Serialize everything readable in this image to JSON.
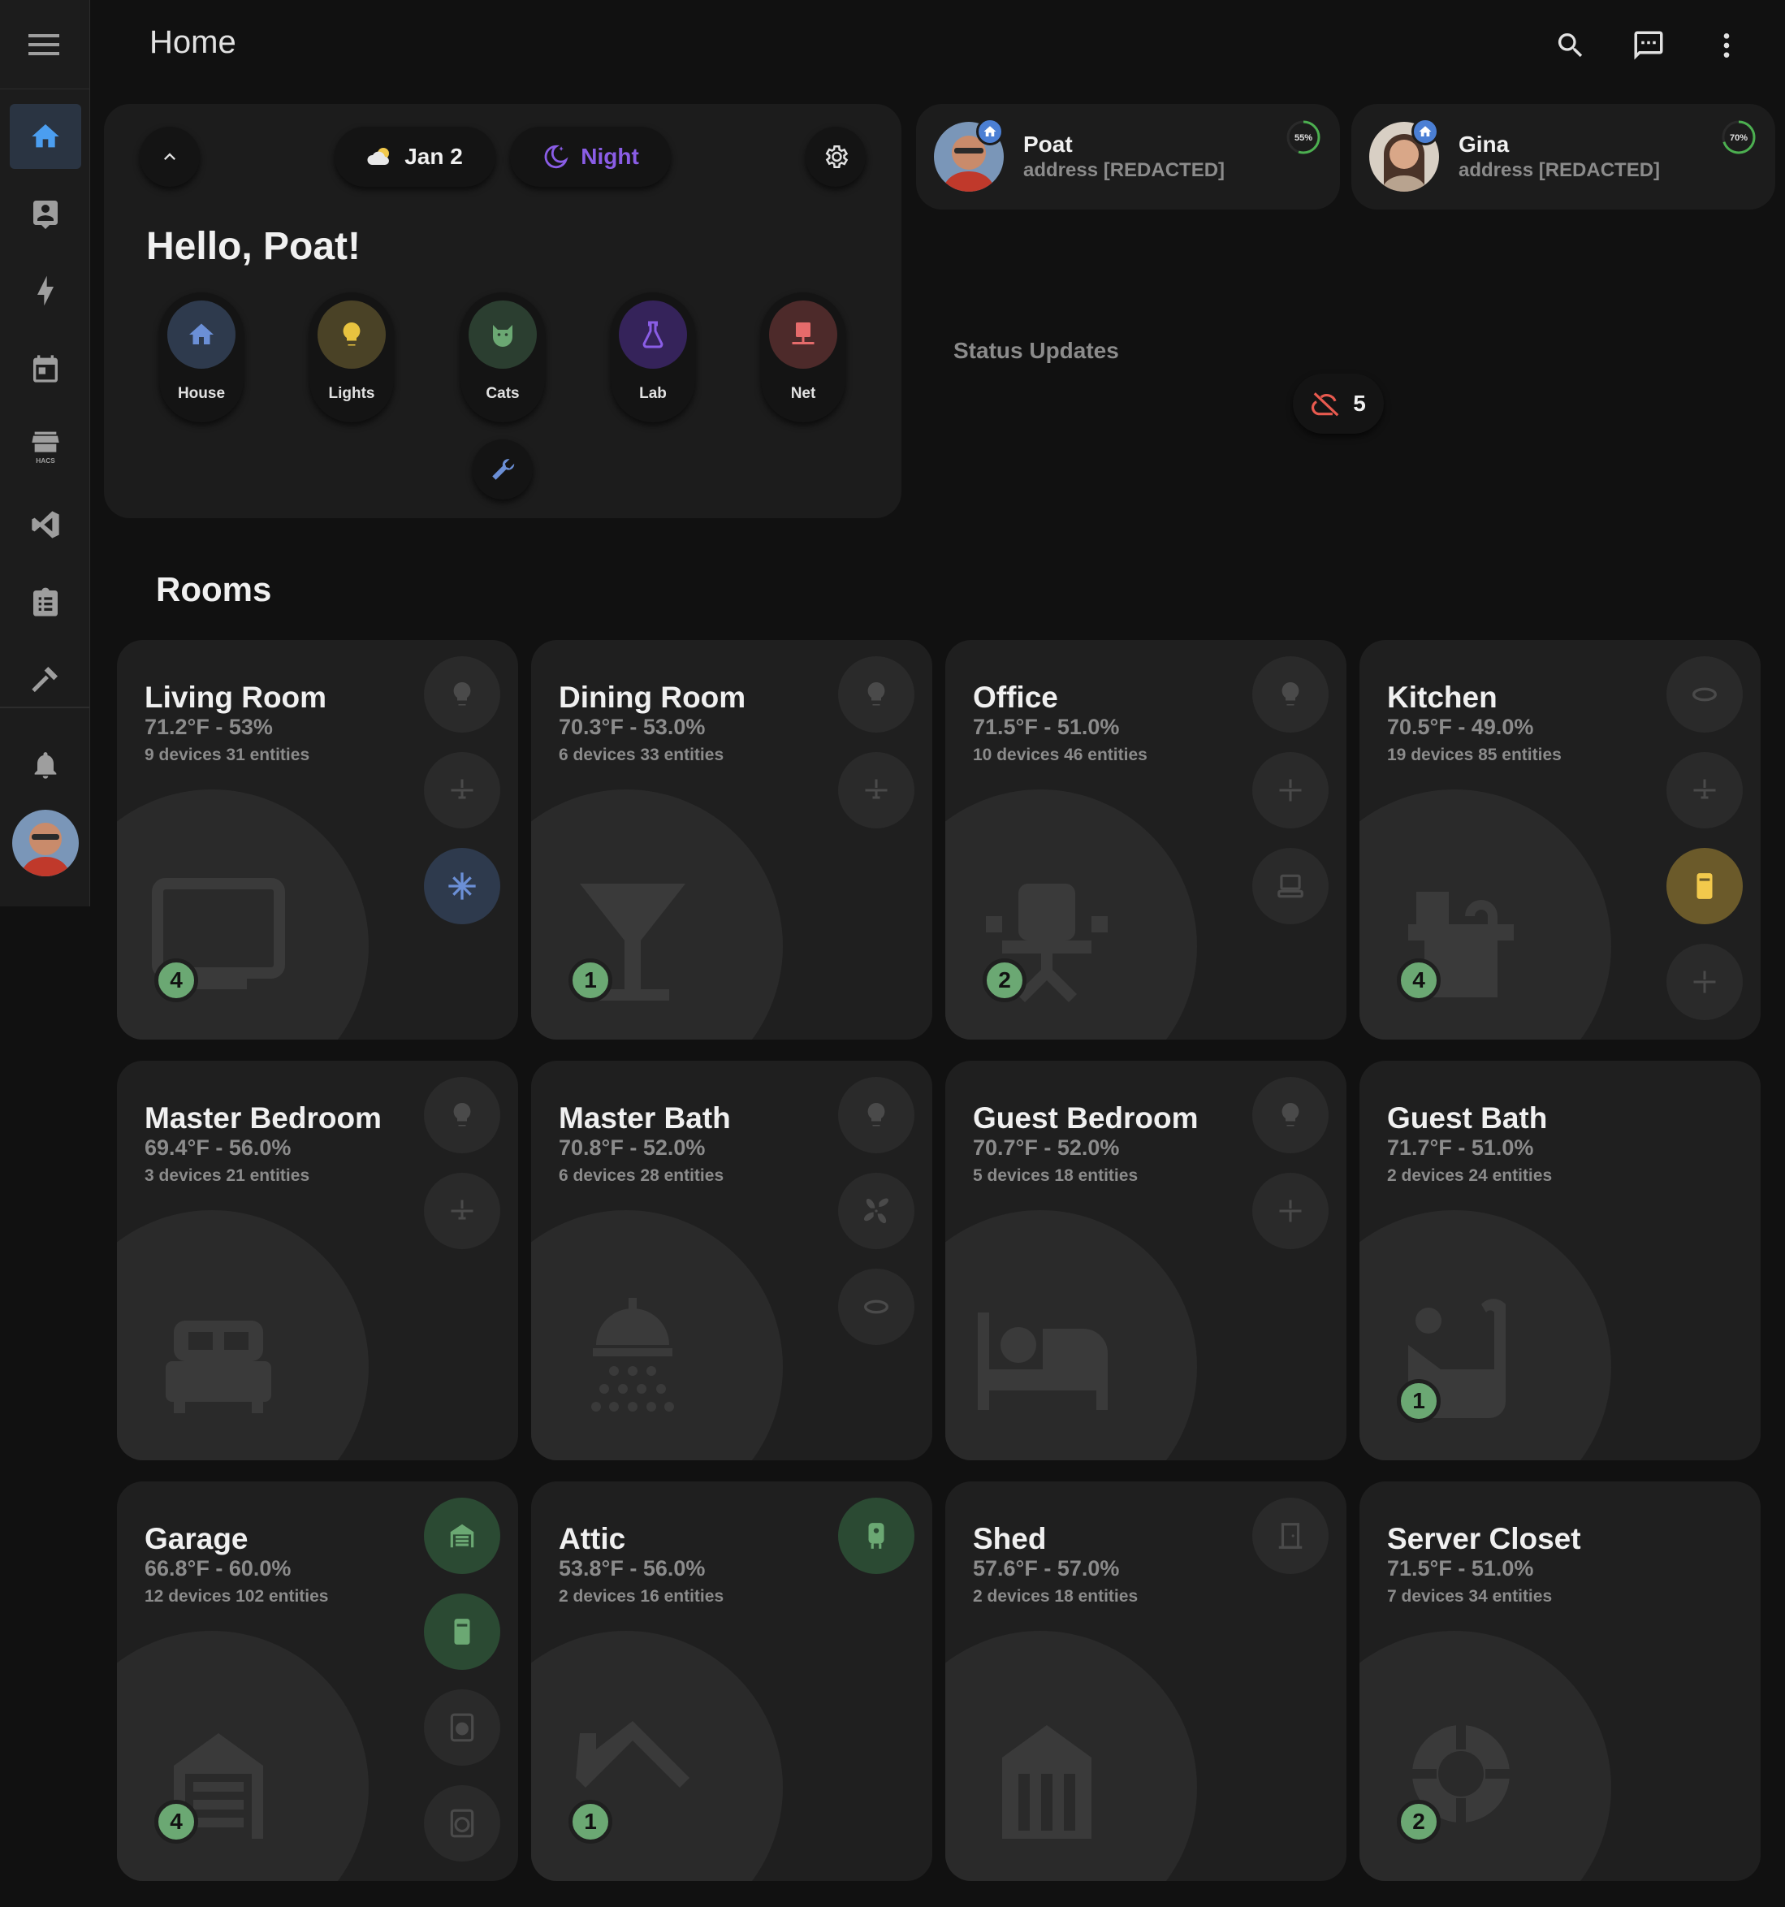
{
  "header": {
    "title": "Home"
  },
  "welcome": {
    "date": "Jan 2",
    "mode": "Night",
    "greeting": "Hello, Poat!",
    "chips": [
      {
        "label": "House",
        "icon": "house-icon",
        "color": "#6b8fd6"
      },
      {
        "label": "Lights",
        "icon": "lightbulb-icon",
        "color": "#e8c33f"
      },
      {
        "label": "Cats",
        "icon": "cat-icon",
        "color": "#6ba873"
      },
      {
        "label": "Lab",
        "icon": "flask-icon",
        "color": "#8a5de6"
      },
      {
        "label": "Net",
        "icon": "server-icon",
        "color": "#e56b6b"
      }
    ]
  },
  "people": [
    {
      "name": "Poat",
      "address": "address [REDACTED]",
      "battery": "55%",
      "battery_level": 0.55
    },
    {
      "name": "Gina",
      "address": "address [REDACTED]",
      "battery": "70%",
      "battery_level": 0.7
    }
  ],
  "status": {
    "title": "Status Updates",
    "count": "5"
  },
  "rooms_title": "Rooms",
  "rooms": [
    {
      "name": "Living Room",
      "temp": "71.2°F - 53%",
      "devices": "9 devices 31 entities",
      "count": "4",
      "icon": "tv-icon"
    },
    {
      "name": "Dining Room",
      "temp": "70.3°F - 53.0%",
      "devices": "6 devices 33 entities",
      "count": "1",
      "icon": "cocktail-glass-icon"
    },
    {
      "name": "Office",
      "temp": "71.5°F - 51.0%",
      "devices": "10 devices 46 entities",
      "count": "2",
      "icon": "office-chair-icon"
    },
    {
      "name": "Kitchen",
      "temp": "70.5°F - 49.0%",
      "devices": "19 devices 85 entities",
      "count": "4",
      "icon": "stove-icon"
    },
    {
      "name": "Master Bedroom",
      "temp": "69.4°F - 56.0%",
      "devices": "3 devices 21 entities",
      "count": "",
      "icon": "bed-icon"
    },
    {
      "name": "Master Bath",
      "temp": "70.8°F - 52.0%",
      "devices": "6 devices 28 entities",
      "count": "",
      "icon": "shower-icon"
    },
    {
      "name": "Guest Bedroom",
      "temp": "70.7°F - 52.0%",
      "devices": "5 devices 18 entities",
      "count": "",
      "icon": "bed-single-icon"
    },
    {
      "name": "Guest Bath",
      "temp": "71.7°F - 51.0%",
      "devices": "2 devices 24 entities",
      "count": "1",
      "icon": "bathtub-icon"
    },
    {
      "name": "Garage",
      "temp": "66.8°F - 60.0%",
      "devices": "12 devices 102 entities",
      "count": "4",
      "icon": "garage-icon"
    },
    {
      "name": "Attic",
      "temp": "53.8°F - 56.0%",
      "devices": "2 devices 16 entities",
      "count": "1",
      "icon": "roof-icon"
    },
    {
      "name": "Shed",
      "temp": "57.6°F - 57.0%",
      "devices": "2 devices 18 entities",
      "count": "",
      "icon": "shed-icon"
    },
    {
      "name": "Server Closet",
      "temp": "71.5°F - 51.0%",
      "devices": "7 devices 34 entities",
      "count": "2",
      "icon": "lifebuoy-icon"
    }
  ]
}
